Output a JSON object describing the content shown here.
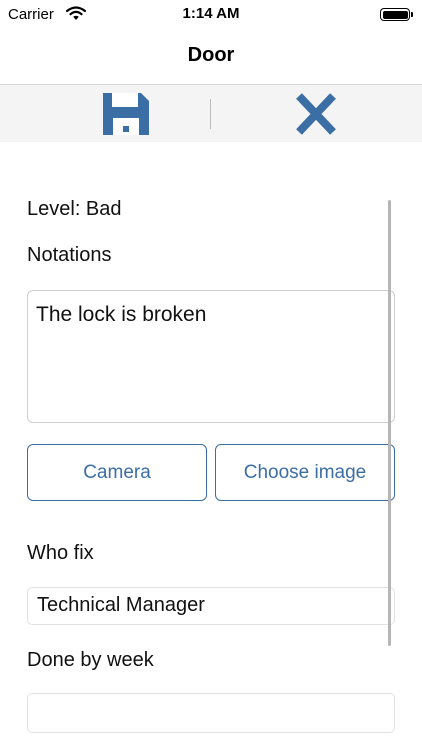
{
  "status_bar": {
    "carrier": "Carrier",
    "time": "1:14 AM",
    "battery_level": 1.0
  },
  "nav": {
    "title": "Door"
  },
  "toolbar": {
    "save_icon": "floppy-disk-icon",
    "close_icon": "close-x-icon",
    "accent_color": "#3b6ea5"
  },
  "form": {
    "level_label": "Level: Bad",
    "notations_label": "Notations",
    "notations_value": "The lock is broken",
    "camera_button": "Camera",
    "choose_image_button": "Choose image",
    "who_fix_label": "Who fix",
    "who_fix_value": "Technical Manager",
    "done_by_week_label": "Done by week",
    "done_by_week_value": ""
  }
}
